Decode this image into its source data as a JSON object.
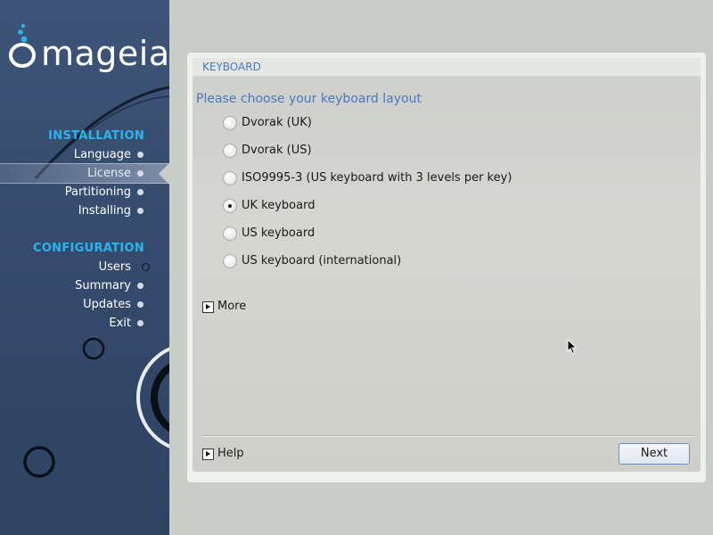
{
  "brand": {
    "wordmark": "mageia",
    "accent_color": "#2bb4ec"
  },
  "sidebar": {
    "sections": [
      {
        "title": "INSTALLATION",
        "steps": [
          {
            "label": "Language",
            "state": "done"
          },
          {
            "label": "License",
            "state": "active"
          },
          {
            "label": "Partitioning",
            "state": "pending"
          },
          {
            "label": "Installing",
            "state": "pending"
          }
        ]
      },
      {
        "title": "CONFIGURATION",
        "steps": [
          {
            "label": "Users",
            "state": "current-ring"
          },
          {
            "label": "Summary",
            "state": "pending"
          },
          {
            "label": "Updates",
            "state": "pending"
          },
          {
            "label": "Exit",
            "state": "pending"
          }
        ]
      }
    ]
  },
  "panel": {
    "header": "KEYBOARD",
    "prompt": "Please choose your keyboard layout",
    "options": [
      {
        "label": "Dvorak (UK)",
        "selected": false
      },
      {
        "label": "Dvorak (US)",
        "selected": false
      },
      {
        "label": "ISO9995-3 (US keyboard with 3 levels per key)",
        "selected": false
      },
      {
        "label": "UK keyboard",
        "selected": true
      },
      {
        "label": "US keyboard",
        "selected": false
      },
      {
        "label": "US keyboard (international)",
        "selected": false
      }
    ],
    "more_label": "More",
    "help_label": "Help",
    "next_label": "Next"
  },
  "icons": {
    "expander": "triangle-right-icon",
    "cursor": "mouse-pointer-icon"
  }
}
